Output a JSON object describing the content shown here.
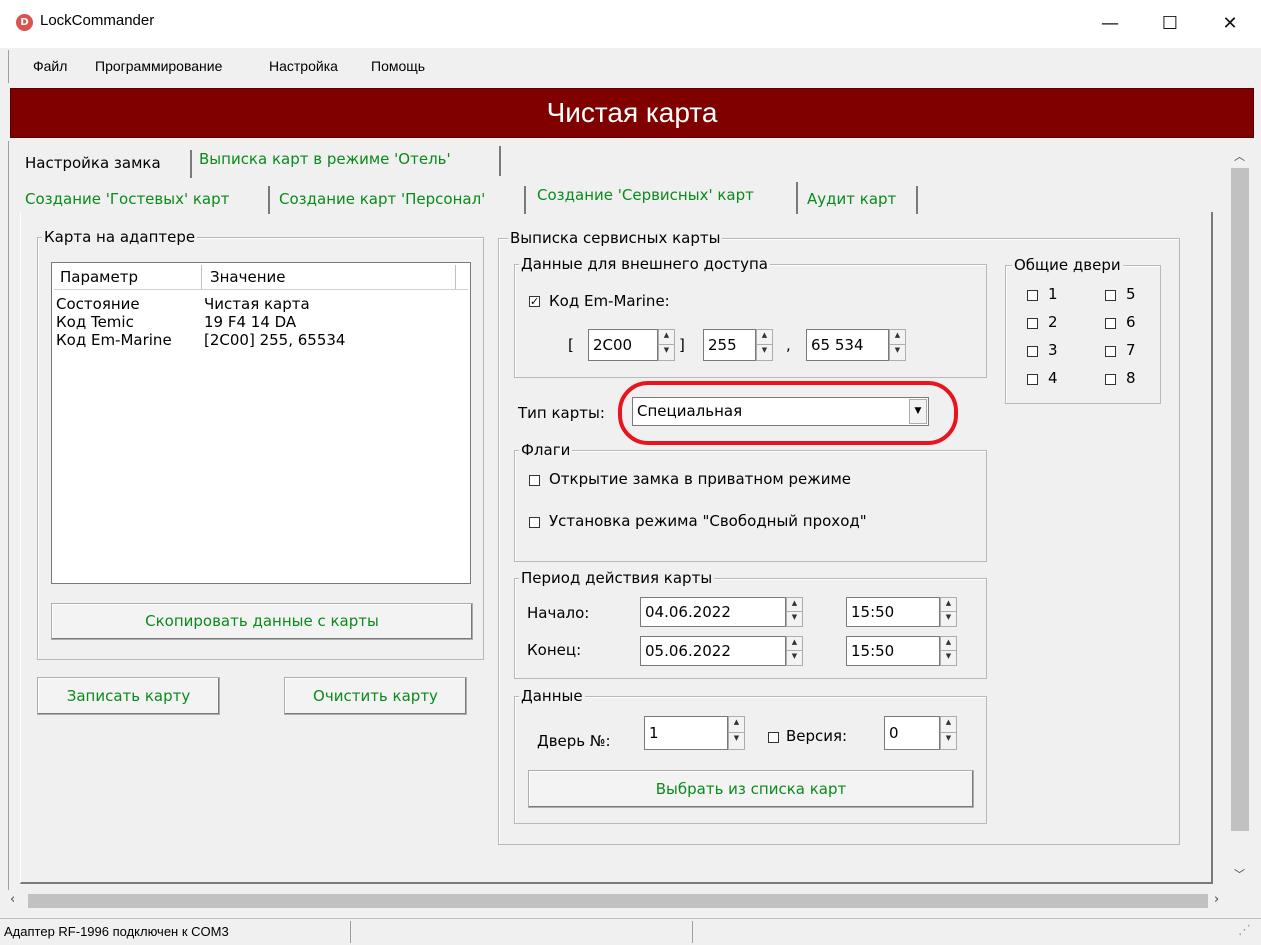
{
  "window": {
    "title": "LockCommander",
    "minimize": "—",
    "maximize": "☐",
    "close": "✕"
  },
  "menu": {
    "items": [
      "Файл",
      "Программирование",
      "Настройка",
      "Помощь"
    ]
  },
  "banner": {
    "text": "Чистая карта"
  },
  "tabs_top": [
    "Настройка замка",
    "Выписка карт в режиме 'Отель'"
  ],
  "tabs_second": [
    "Создание 'Гостевых' карт",
    "Создание карт 'Персонал'",
    "Создание 'Сервисных' карт",
    "Аудит карт"
  ],
  "card_on_adapter": {
    "label": "Карта на адаптере",
    "columns": [
      "Параметр",
      "Значение"
    ],
    "rows": [
      {
        "param": "Состояние",
        "value": "Чистая карта"
      },
      {
        "param": "Код Temic",
        "value": "19 F4 14 DA"
      },
      {
        "param": "Код Em-Marine",
        "value": "[2C00] 255, 65534"
      }
    ],
    "copy_button": "Скопировать данные с карты"
  },
  "buttons": {
    "write": "Записать карту",
    "clear": "Очистить карту"
  },
  "service": {
    "label": "Выписка сервисных карты",
    "external": {
      "label": "Данные для внешнего доступа",
      "em_marine_label": "Код Em-Marine:",
      "em_checked": true,
      "open_bracket": "[",
      "close_bracket": "]",
      "comma": ",",
      "f1": "2C00",
      "f2": "255",
      "f3": "65 534"
    },
    "doors": {
      "label": "Общие двери",
      "items": [
        "1",
        "2",
        "3",
        "4",
        "5",
        "6",
        "7",
        "8"
      ]
    },
    "card_type": {
      "label": "Тип карты:",
      "value": "Специальная"
    },
    "flags": {
      "label": "Флаги",
      "items": [
        "Открытие замка в приватном режиме",
        "Установка режима \"Свободный проход\""
      ]
    },
    "period": {
      "label": "Период действия карты",
      "start_label": "Начало:",
      "end_label": "Конец:",
      "start_date": "04.06.2022",
      "start_time": "15:50",
      "end_date": "05.06.2022",
      "end_time": "15:50"
    },
    "data": {
      "label": "Данные",
      "door_label": "Дверь №:",
      "door_value": "1",
      "version_label": "Версия:",
      "version_value": "0",
      "select_button": "Выбрать из списка карт"
    }
  },
  "status": {
    "text": "Адаптер RF-1996 подключен к COM3"
  },
  "colors": {
    "banner": "#800000",
    "accent_text": "#0a8a1a",
    "highlight": "#e8141e"
  }
}
